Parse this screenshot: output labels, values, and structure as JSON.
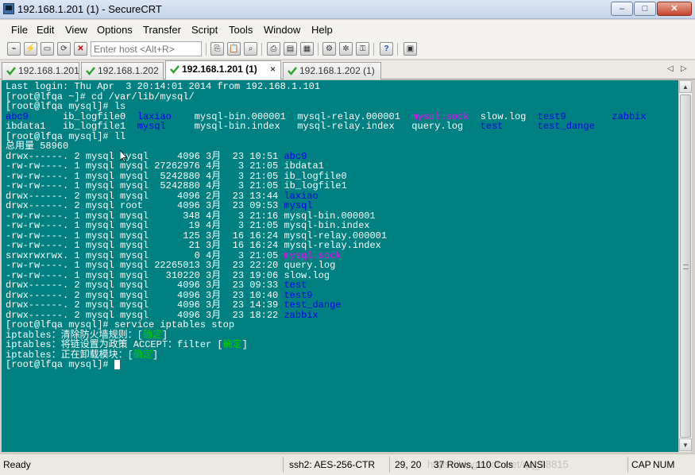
{
  "window": {
    "title": "192.168.1.201 (1) - SecureCRT",
    "minimize": "–",
    "maximize": "□",
    "close": "✕"
  },
  "menu": [
    "File",
    "Edit",
    "View",
    "Options",
    "Transfer",
    "Script",
    "Tools",
    "Window",
    "Help"
  ],
  "toolbar": {
    "host_placeholder": "Enter host <Alt+R>"
  },
  "tabs": [
    {
      "label": "192.168.1.201",
      "active": false
    },
    {
      "label": "192.168.1.202",
      "active": false
    },
    {
      "label": "192.168.1.201 (1)",
      "active": true,
      "close": "×"
    },
    {
      "label": "192.168.1.202 (1)",
      "active": false
    }
  ],
  "tab_nav": {
    "prev": "◁",
    "next": "▷"
  },
  "colors": {
    "terminal_bg": "#008080",
    "terminal_fg": "#ffffff",
    "dir": "#0000ee",
    "socket": "#ff00ff",
    "ok": "#00cc00",
    "check": "#2ea02e"
  },
  "terminal": {
    "lines": [
      [
        {
          "t": "Last login: Thu Apr  3 20:14:01 2014 from 192.168.1.101"
        }
      ],
      [
        {
          "t": "[root@lfqa ~]# cd /var/lib/mysql/"
        }
      ],
      [
        {
          "t": "[root@lfqa mysql]# ls"
        }
      ],
      [
        {
          "t": "abc9",
          "c": "blue"
        },
        {
          "t": "      ib_logfile0  "
        },
        {
          "t": "laxiao",
          "c": "blue"
        },
        {
          "t": "    mysql-bin.000001  mysql-relay.000001  "
        },
        {
          "t": "mysql.sock",
          "c": "magenta"
        },
        {
          "t": "  slow.log  "
        },
        {
          "t": "test9",
          "c": "blue"
        },
        {
          "t": "        "
        },
        {
          "t": "zabbix",
          "c": "blue"
        }
      ],
      [
        {
          "t": "ibdata1   ib_logfile1  "
        },
        {
          "t": "mysql",
          "c": "blue"
        },
        {
          "t": "     mysql-bin.index   mysql-relay.index   query.log   "
        },
        {
          "t": "test",
          "c": "blue"
        },
        {
          "t": "      "
        },
        {
          "t": "test_dange",
          "c": "blue"
        }
      ],
      [
        {
          "t": "[root@lfqa mysql]# ll"
        }
      ],
      [
        {
          "t": "总用量 58960"
        }
      ],
      [
        {
          "t": "drwx------. 2 mysql mysql     4096 3月  23 10:51 "
        },
        {
          "t": "abc9",
          "c": "blue"
        }
      ],
      [
        {
          "t": "-rw-rw----. 1 mysql mysql 27262976 4月   3 21:05 ibdata1"
        }
      ],
      [
        {
          "t": "-rw-rw----. 1 mysql mysql  5242880 4月   3 21:05 ib_logfile0"
        }
      ],
      [
        {
          "t": "-rw-rw----. 1 mysql mysql  5242880 4月   3 21:05 ib_logfile1"
        }
      ],
      [
        {
          "t": "drwx------. 2 mysql mysql     4096 2月  23 13:44 "
        },
        {
          "t": "laxiao",
          "c": "blue"
        }
      ],
      [
        {
          "t": "drwx------. 2 mysql root      4096 3月  23 09:53 "
        },
        {
          "t": "mysql",
          "c": "blue"
        }
      ],
      [
        {
          "t": "-rw-rw----. 1 mysql mysql      348 4月   3 21:16 mysql-bin.000001"
        }
      ],
      [
        {
          "t": "-rw-rw----. 1 mysql mysql       19 4月   3 21:05 mysql-bin.index"
        }
      ],
      [
        {
          "t": "-rw-rw----. 1 mysql mysql      125 3月  16 16:24 mysql-relay.000001"
        }
      ],
      [
        {
          "t": "-rw-rw----. 1 mysql mysql       21 3月  16 16:24 mysql-relay.index"
        }
      ],
      [
        {
          "t": "srwxrwxrwx. 1 mysql mysql        0 4月   3 21:05 "
        },
        {
          "t": "mysql.sock",
          "c": "magenta"
        }
      ],
      [
        {
          "t": "-rw-rw----. 1 mysql mysql 22265013 3月  23 22:20 query.log"
        }
      ],
      [
        {
          "t": "-rw-rw----. 1 mysql mysql   310220 3月  23 19:06 slow.log"
        }
      ],
      [
        {
          "t": "drwx------. 2 mysql mysql     4096 3月  23 09:33 "
        },
        {
          "t": "test",
          "c": "blue"
        }
      ],
      [
        {
          "t": "drwx------. 2 mysql mysql     4096 3月  23 10:40 "
        },
        {
          "t": "test9",
          "c": "blue"
        }
      ],
      [
        {
          "t": "drwx------. 2 mysql mysql     4096 3月  23 14:39 "
        },
        {
          "t": "test_dange",
          "c": "blue"
        }
      ],
      [
        {
          "t": "drwx------. 2 mysql mysql     4096 3月  23 18:22 "
        },
        {
          "t": "zabbix",
          "c": "blue"
        }
      ],
      [
        {
          "t": "[root@lfqa mysql]# service iptables stop"
        }
      ],
      [
        {
          "t": "iptables：清除防火墙规则：["
        },
        {
          "t": "确定",
          "c": "green"
        },
        {
          "t": "]"
        }
      ],
      [
        {
          "t": "iptables：将链设置为政策 ACCEPT：filter ["
        },
        {
          "t": "确定",
          "c": "green"
        },
        {
          "t": "]"
        }
      ],
      [
        {
          "t": "iptables：正在卸载模块：["
        },
        {
          "t": "确定",
          "c": "green"
        },
        {
          "t": "]"
        }
      ],
      [
        {
          "t": "[root@lfqa mysql]# "
        },
        {
          "t": "",
          "c": "cursor"
        }
      ]
    ]
  },
  "statusbar": {
    "ready": "Ready",
    "cipher": "ssh2: AES-256-CTR",
    "position": "29,  20",
    "size": "37 Rows, 110 Cols",
    "charset": "ANSI",
    "caps": "CAP",
    "num": "NUM",
    "watermark": "https://blog.csdn.net/qq_38815"
  }
}
